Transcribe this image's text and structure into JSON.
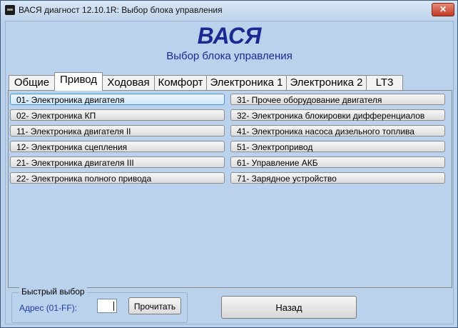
{
  "window": {
    "title": "ВАСЯ диагност 12.10.1R:  Выбор блока управления",
    "close_label": "✕"
  },
  "header": {
    "app_name": "ВАСЯ",
    "subtitle": "Выбор блока управления"
  },
  "tabs": [
    {
      "label": "Общие",
      "active": false
    },
    {
      "label": "Привод",
      "active": true
    },
    {
      "label": "Ходовая",
      "active": false
    },
    {
      "label": "Комфорт",
      "active": false
    },
    {
      "label": "Электроника 1",
      "active": false
    },
    {
      "label": "Электроника 2",
      "active": false
    },
    {
      "label": "LT3",
      "active": false
    }
  ],
  "units": {
    "left": [
      "01- Электроника двигателя",
      "02- Электроника КП",
      "11- Электроника двигателя II",
      "12- Электроника сцепления",
      "21- Электроника двигателя III",
      "22- Электроника полного привода"
    ],
    "right": [
      "31- Прочее оборудование двигателя",
      "32- Электроника блокировки дифференциалов",
      "41- Электроника насоса дизельного топлива",
      "51- Электропривод",
      "61- Управление АКБ",
      "71- Зарядное устройство"
    ]
  },
  "quick_select": {
    "legend": "Быстрый выбор",
    "address_label": "Адрес (01-FF):",
    "address_value": "",
    "read_label": "Прочитать"
  },
  "back_label": "Назад"
}
